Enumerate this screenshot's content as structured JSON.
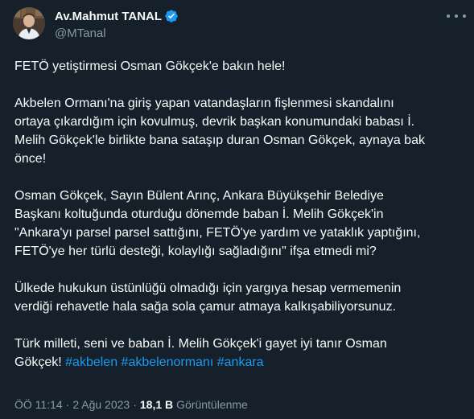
{
  "author": {
    "name": "Av.Mahmut TANAL",
    "handle": "@MTanal"
  },
  "tweet": {
    "paragraphs": [
      "FETÖ yetiştirmesi Osman Gökçek'e bakın hele!",
      "Akbelen Ormanı'na giriş yapan vatandaşların fişlenmesi skandalını ortaya çıkardığım için kovulmuş, devrik başkan konumundaki babası İ. Melih Gökçek'le birlikte bana sataşıp duran Osman Gökçek, aynaya bak önce!",
      "Osman Gökçek, Sayın Bülent Arınç, Ankara Büyükşehir Belediye Başkanı koltuğunda oturduğu dönemde baban İ. Melih Gökçek'in \"Ankara'yı parsel parsel sattığını, FETÖ'ye yardım ve yataklık yaptığını, FETÖ'ye her türlü desteği, kolaylığı sağladığını\" ifşa etmedi mi?",
      "Ülkede hukukun üstünlüğü olmadığı için yargıya hesap vermemenin verdiği rehavetle hala sağa sola çamur atmaya kalkışabiliyorsunuz."
    ],
    "last_paragraph_text": "Türk milleti, seni ve baban İ. Melih Gökçek'i gayet iyi tanır Osman Gökçek! ",
    "hashtags": [
      "#akbelen",
      "#akbelenormanı",
      "#ankara"
    ]
  },
  "meta": {
    "time": "ÖÖ 11:14",
    "date": "2 Ağu 2023",
    "separator": "·",
    "views_count": "18,1 B",
    "views_label": "Görüntülenme"
  },
  "colors": {
    "background": "#15202b",
    "text": "#f7f9f9",
    "secondary": "#8b98a5",
    "accent": "#1d9bf0"
  },
  "icons": {
    "verified": "verified-badge-icon",
    "more": "more-options-icon"
  }
}
